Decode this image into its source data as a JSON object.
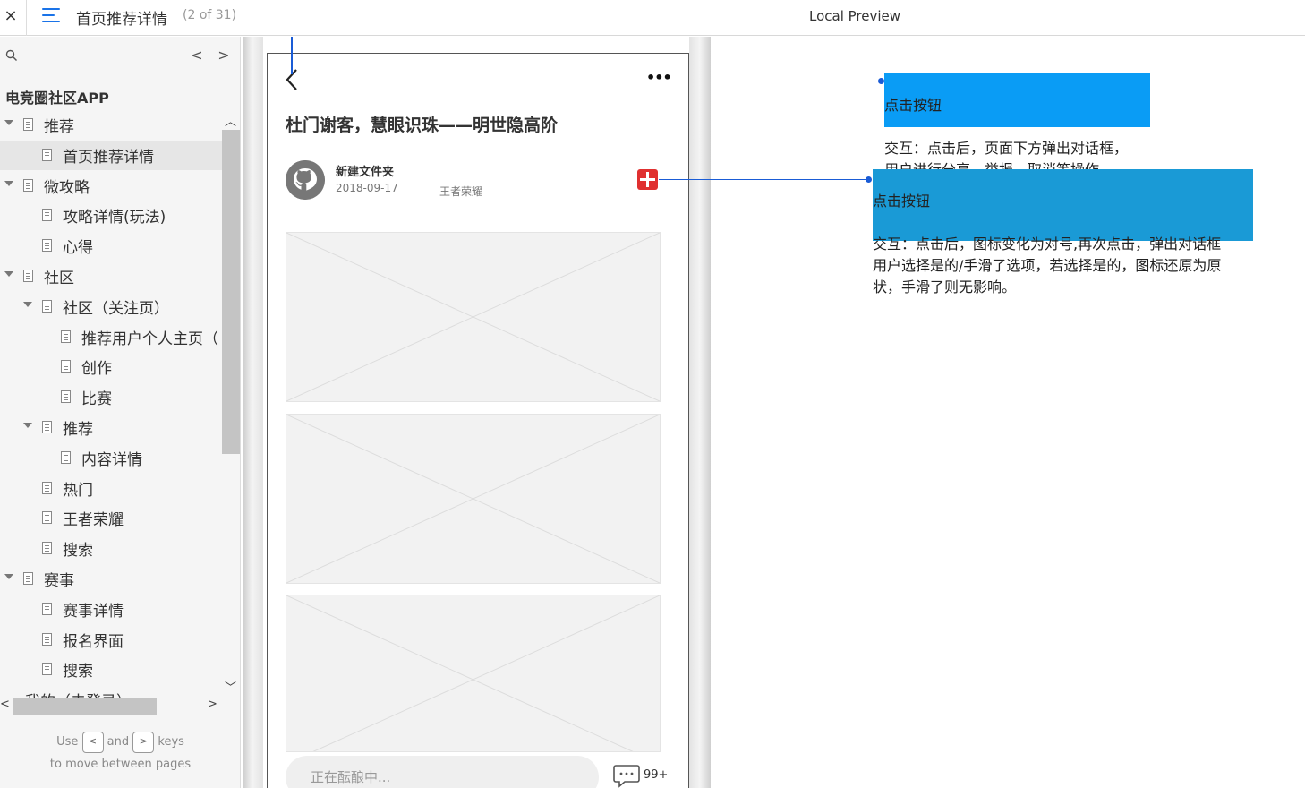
{
  "topbar": {
    "close_label": "×",
    "page_title": "首页推荐详情",
    "page_count": "(2 of 31)",
    "preview_label": "Local Preview"
  },
  "sidebar": {
    "nav_prev": "<",
    "nav_next": ">",
    "project_title": "电竞圈社区APP",
    "items": [
      {
        "label": "推荐",
        "level": 0,
        "expandable": true
      },
      {
        "label": "首页推荐详情",
        "level": 1,
        "expandable": false,
        "selected": true
      },
      {
        "label": "微攻略",
        "level": 0,
        "expandable": true
      },
      {
        "label": "攻略详情(玩法)",
        "level": 1,
        "expandable": false
      },
      {
        "label": "心得",
        "level": 1,
        "expandable": false
      },
      {
        "label": "社区",
        "level": 0,
        "expandable": true
      },
      {
        "label": "社区（关注页）",
        "level": 1,
        "expandable": true
      },
      {
        "label": "推荐用户个人主页（",
        "level": 2,
        "expandable": false
      },
      {
        "label": "创作",
        "level": 2,
        "expandable": false
      },
      {
        "label": "比赛",
        "level": 2,
        "expandable": false
      },
      {
        "label": "推荐",
        "level": 1,
        "expandable": true
      },
      {
        "label": "内容详情",
        "level": 2,
        "expandable": false
      },
      {
        "label": "热门",
        "level": 1,
        "expandable": false
      },
      {
        "label": "王者荣耀",
        "level": 1,
        "expandable": false
      },
      {
        "label": "搜索",
        "level": 1,
        "expandable": false
      },
      {
        "label": "赛事",
        "level": 0,
        "expandable": true
      },
      {
        "label": "赛事详情",
        "level": 1,
        "expandable": false
      },
      {
        "label": "报名界面",
        "level": 1,
        "expandable": false
      },
      {
        "label": "搜索",
        "level": 1,
        "expandable": false
      }
    ],
    "partial_item": "我的（未登录）",
    "hint_use": "Use",
    "hint_key_prev": "<",
    "hint_and": "and",
    "hint_key_next": ">",
    "hint_keys": "keys",
    "hint_line2": "to move between pages"
  },
  "phone": {
    "more_label": "•••",
    "article_title": "杜门谢客，慧眼识珠——明世隐高阶",
    "author": "新建文件夹",
    "date": "2018-09-17",
    "tag": "王者荣耀",
    "comment_placeholder": "正在酝酿中...",
    "comment_count": "99+"
  },
  "annotations": [
    {
      "title": "点击按钮",
      "body": "交互：点击后，页面下方弹出对话框，\n用户进行分享、举报、取消等操作。",
      "color": "#0a9cf5"
    },
    {
      "title": "点击按钮",
      "body": "交互：点击后，图标变化为对号,再次点击，弹出对话框\n用户选择是的/手滑了选项，若选择是的，图标还原为原\n状，手滑了则无影响。",
      "color": "#1a9ad6"
    }
  ]
}
